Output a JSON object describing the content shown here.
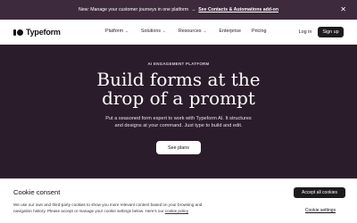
{
  "announcement": {
    "message": "New: Manage your customer journeys in one platform",
    "arrow": "→",
    "cta": "See Contacts & Automations add-on",
    "close_icon": "close-icon",
    "close_glyph": "✕"
  },
  "nav": {
    "logo_text": "Typeform",
    "items": [
      {
        "label": "Platform",
        "chevron": "⌄"
      },
      {
        "label": "Solutions",
        "chevron": "⌄"
      },
      {
        "label": "Resources",
        "chevron": "⌄"
      },
      {
        "label": "Enterprise"
      },
      {
        "label": "Pricing"
      }
    ],
    "login_label": "Log in",
    "signup_label": "Sign up"
  },
  "hero": {
    "eyebrow": "AI ENGAGEMENT PLATFORM",
    "headline_line1": "Build forms at the",
    "headline_line2": "drop of a prompt",
    "sub_line1": "Put a seasoned form expert to work with Typeform AI. It structures",
    "sub_line2": "and designs at your command. Just type to build and edit.",
    "cta_label": "See plans"
  },
  "cookie": {
    "title": "Cookie consent",
    "body_line1": "We use our own and third-party cookies to show you more relevant content based on your browsing and",
    "body_line2_prefix": "navigation history. Please accept or manage your cookie settings below. Here's our ",
    "policy_link": "cookie policy",
    "accept_label": "Accept all cookies",
    "settings_label": "Cookie settings"
  },
  "colors": {
    "announcement_bg": "#3d2a3c",
    "hero_bg": "#2b1c2b",
    "button_dark": "#1c1c1c"
  }
}
